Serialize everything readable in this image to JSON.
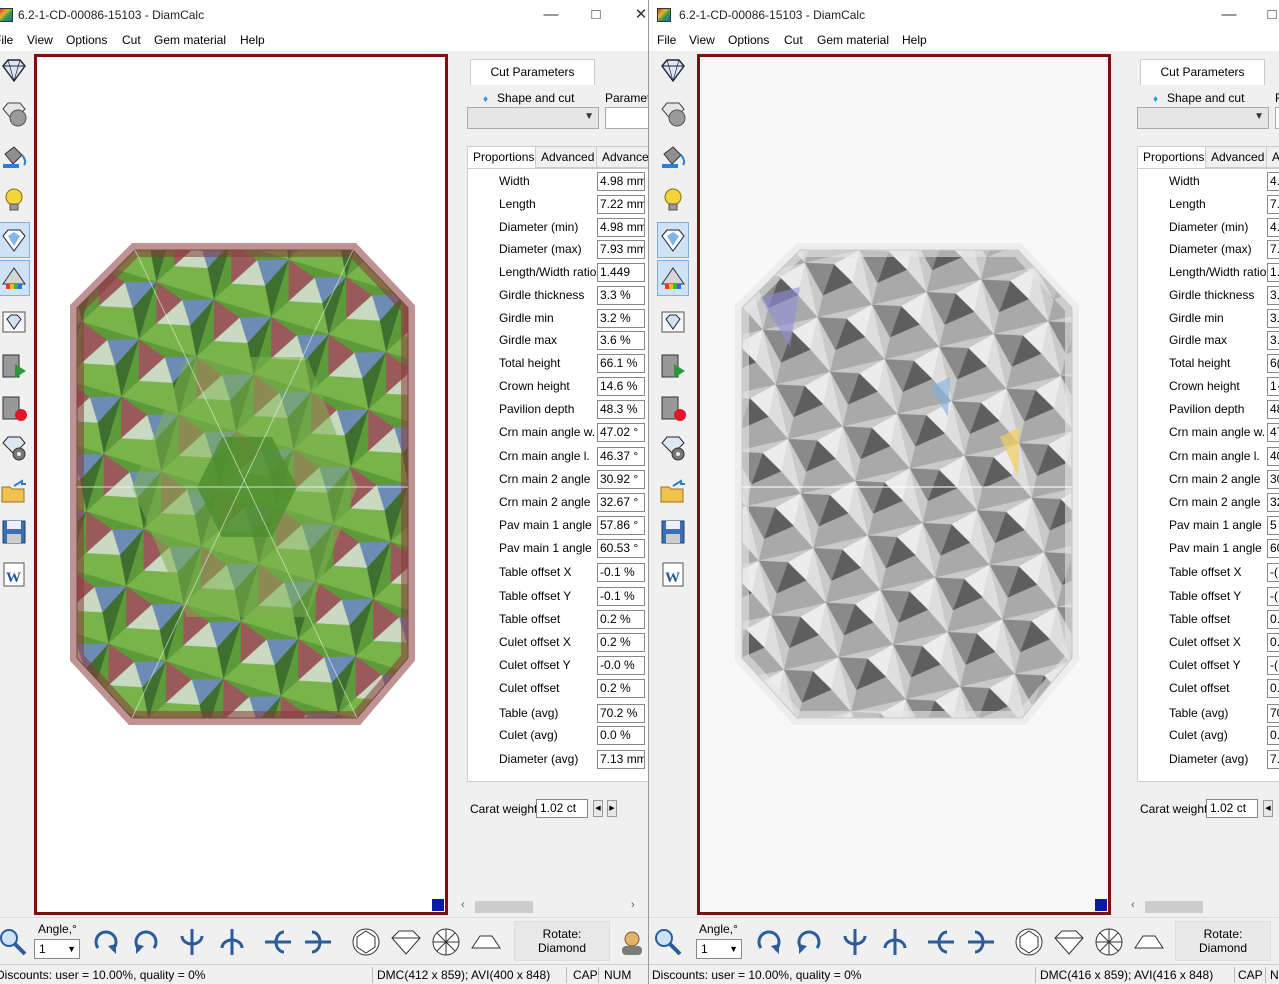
{
  "windows": [
    {
      "id": "left",
      "title": "6.2-1-CD-00086-15103 - DiamCalc",
      "menu": [
        "File",
        "View",
        "Options",
        "Cut",
        "Gem material",
        "Help"
      ],
      "panel": {
        "tab": "Cut Parameters",
        "shape_label": "Shape and cut",
        "param_label": "Paramet",
        "subtabs": [
          "Proportions",
          "Advanced",
          "Advance"
        ],
        "params": [
          {
            "label": "Width",
            "value": "4.98 mm"
          },
          {
            "label": "Length",
            "value": "7.22 mm"
          },
          {
            "label": "Diameter (min)",
            "value": "4.98 mm"
          },
          {
            "label": "Diameter (max)",
            "value": "7.93 mm"
          },
          {
            "label": "Length/Width ratio",
            "value": "1.449"
          },
          {
            "label": "Girdle thickness",
            "value": "3.3 %"
          },
          {
            "label": "Girdle min",
            "value": "3.2 %"
          },
          {
            "label": "Girdle max",
            "value": "3.6 %"
          },
          {
            "label": "Total height",
            "value": "66.1 %"
          },
          {
            "label": "Crown height",
            "value": "14.6 %"
          },
          {
            "label": "Pavilion depth",
            "value": "48.3 %"
          },
          {
            "label": "Crn main angle w.",
            "value": "47.02 °"
          },
          {
            "label": "Crn main angle l.",
            "value": "46.37 °"
          },
          {
            "label": "Crn main 2 angle",
            "value": "30.92 °"
          },
          {
            "label": "Crn main 2 angle",
            "value": "32.67 °"
          },
          {
            "label": "Pav main 1 angle",
            "value": "57.86 °"
          },
          {
            "label": "Pav main 1 angle",
            "value": "60.53 °"
          },
          {
            "label": "Table offset X",
            "value": "-0.1 %"
          },
          {
            "label": "Table offset Y",
            "value": "-0.1 %"
          },
          {
            "label": "Table offset",
            "value": "0.2 %"
          },
          {
            "label": "Culet offset X",
            "value": "0.2 %"
          },
          {
            "label": "Culet offset Y",
            "value": "-0.0 %"
          },
          {
            "label": "Culet offset",
            "value": "0.2 %"
          },
          {
            "label": "Table (avg)",
            "value": "70.2 %"
          },
          {
            "label": "Culet (avg)",
            "value": "0.0 %"
          },
          {
            "label": "Diameter (avg)",
            "value": "7.13 mm"
          }
        ],
        "carat_label": "Carat weight",
        "carat_value": "1.02 ct"
      },
      "bottom": {
        "angle_label": "Angle,°",
        "angle_value": "1",
        "rotate_label": "Rotate:",
        "rotate_value": "Diamond"
      },
      "status": {
        "discounts": "Discounts: user = 10.00%, quality = 0%",
        "dmc": "DMC(412 x 859); AVI(400 x 848)",
        "cap": "CAP",
        "num": "NUM"
      }
    },
    {
      "id": "right",
      "title": "6.2-1-CD-00086-15103 - DiamCalc",
      "menu": [
        "File",
        "View",
        "Options",
        "Cut",
        "Gem material",
        "Help"
      ],
      "panel": {
        "tab": "Cut Parameters",
        "shape_label": "Shape and cut",
        "param_label": "F",
        "subtabs": [
          "Proportions",
          "Advanced",
          "A"
        ],
        "params": [
          {
            "label": "Width",
            "value": "4."
          },
          {
            "label": "Length",
            "value": "7."
          },
          {
            "label": "Diameter (min)",
            "value": "4."
          },
          {
            "label": "Diameter (max)",
            "value": "7."
          },
          {
            "label": "Length/Width ratio",
            "value": "1."
          },
          {
            "label": "Girdle thickness",
            "value": "3."
          },
          {
            "label": "Girdle min",
            "value": "3."
          },
          {
            "label": "Girdle max",
            "value": "3."
          },
          {
            "label": "Total height",
            "value": "6("
          },
          {
            "label": "Crown height",
            "value": "1·"
          },
          {
            "label": "Pavilion depth",
            "value": "48"
          },
          {
            "label": "Crn main angle w.",
            "value": "47"
          },
          {
            "label": "Crn main angle l.",
            "value": "40"
          },
          {
            "label": "Crn main 2 angle",
            "value": "30"
          },
          {
            "label": "Crn main 2 angle",
            "value": "32"
          },
          {
            "label": "Pav main 1 angle",
            "value": "5"
          },
          {
            "label": "Pav main 1 angle",
            "value": "60"
          },
          {
            "label": "Table offset X",
            "value": "-("
          },
          {
            "label": "Table offset Y",
            "value": "-("
          },
          {
            "label": "Table offset",
            "value": "0."
          },
          {
            "label": "Culet offset X",
            "value": "0."
          },
          {
            "label": "Culet offset Y",
            "value": "-("
          },
          {
            "label": "Culet offset",
            "value": "0."
          },
          {
            "label": "Table (avg)",
            "value": "70"
          },
          {
            "label": "Culet (avg)",
            "value": "0."
          },
          {
            "label": "Diameter (avg)",
            "value": "7."
          }
        ],
        "carat_label": "Carat weight",
        "carat_value": "1.02 ct"
      },
      "bottom": {
        "angle_label": "Angle,°",
        "angle_value": "1",
        "rotate_label": "Rotate:",
        "rotate_value": "Diamond"
      },
      "status": {
        "discounts": "Discounts: user = 10.00%, quality = 0%",
        "dmc": "DMC(416 x 859); AVI(416 x 848)",
        "cap": "CAP",
        "num": "N"
      }
    }
  ],
  "icons": {
    "toolbar": [
      "diamond-outline-icon",
      "sphere-diamond-icon",
      "paint-bucket-icon",
      "lightbulb-icon",
      "diamond-scintillation-icon",
      "prism-spectrum-icon",
      "diamond-photo-icon",
      "video-play-icon",
      "video-record-icon",
      "gear-diamond-icon",
      "open-folder-icon",
      "save-disk-icon",
      "word-export-icon"
    ],
    "bottom": [
      "zoom-icon",
      "rotate-cw-icon",
      "rotate-ccw-icon",
      "flip-horizontal-icon",
      "flip-horizontal-2-icon",
      "flip-vertical-icon",
      "flip-vertical-2-icon",
      "top-view-icon",
      "side-view-icon",
      "bottom-view-icon",
      "profile-view-icon"
    ]
  },
  "colors": {
    "viewport_border": "#7a1010",
    "corner_marker": "#0a1aa8",
    "active_tool": "#cfe3f7"
  }
}
